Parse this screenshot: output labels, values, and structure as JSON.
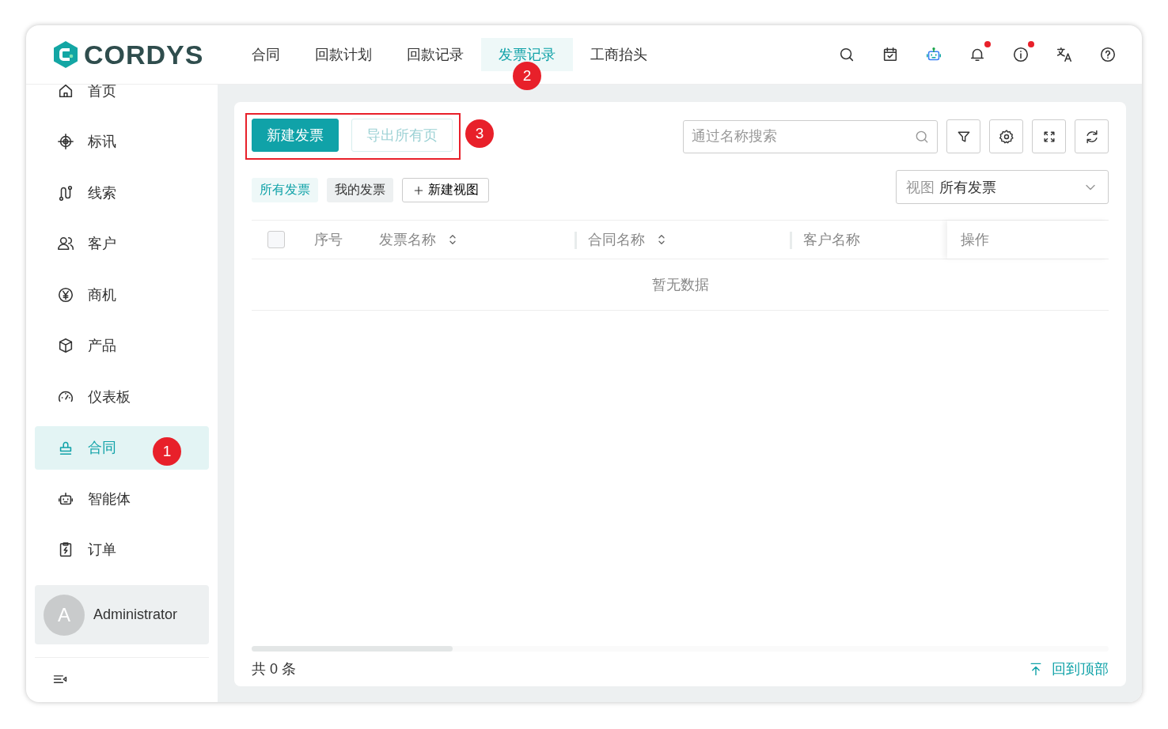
{
  "logo": {
    "text": "CORDYS"
  },
  "nav": {
    "tabs": [
      {
        "label": "合同",
        "selected": false
      },
      {
        "label": "回款计划",
        "selected": false
      },
      {
        "label": "回款记录",
        "selected": false
      },
      {
        "label": "发票记录",
        "selected": true,
        "marker": "2"
      },
      {
        "label": "工商抬头",
        "selected": false
      }
    ]
  },
  "header_icons": [
    {
      "kind": "search",
      "dot": false
    },
    {
      "kind": "calendar",
      "dot": false
    },
    {
      "kind": "robot",
      "dot": false
    },
    {
      "kind": "bell",
      "dot": true
    },
    {
      "kind": "info",
      "dot": true
    },
    {
      "kind": "translate",
      "dot": false
    },
    {
      "kind": "help",
      "dot": false
    }
  ],
  "sidebar": {
    "items": [
      {
        "label": "首页",
        "selected": false
      },
      {
        "label": "标讯",
        "selected": false
      },
      {
        "label": "线索",
        "selected": false
      },
      {
        "label": "客户",
        "selected": false
      },
      {
        "label": "商机",
        "selected": false
      },
      {
        "label": "产品",
        "selected": false
      },
      {
        "label": "仪表板",
        "selected": false
      },
      {
        "label": "合同",
        "selected": true,
        "marker": "1"
      },
      {
        "label": "智能体",
        "selected": false
      },
      {
        "label": "订单",
        "selected": false
      }
    ],
    "user": {
      "initial": "A",
      "name": "Administrator"
    }
  },
  "toolbar": {
    "marker": "3",
    "buttons": [
      {
        "label": "新建发票",
        "kind": "primary",
        "disabled": false
      },
      {
        "label": "导出所有页",
        "kind": "secondary",
        "disabled": true
      }
    ],
    "search": {
      "placeholder": "通过名称搜索"
    }
  },
  "views": {
    "tabs": [
      {
        "label": "所有发票",
        "selected": true
      },
      {
        "label": "我的发票",
        "selected": false
      }
    ],
    "add_button": "新建视图",
    "select": {
      "prefix": "视图",
      "value": "所有发票"
    }
  },
  "table": {
    "select_all_checked": false,
    "columns": [
      {
        "label": "序号",
        "sortable": false
      },
      {
        "label": "发票名称",
        "sortable": true
      },
      {
        "label": "合同名称",
        "sortable": true
      },
      {
        "label": "客户名称",
        "sortable": false
      },
      {
        "label": "操作",
        "sortable": false
      }
    ],
    "empty_text": "暂无数据"
  },
  "footer": {
    "total": "共 0 条",
    "back_to_top": "回到顶部"
  }
}
